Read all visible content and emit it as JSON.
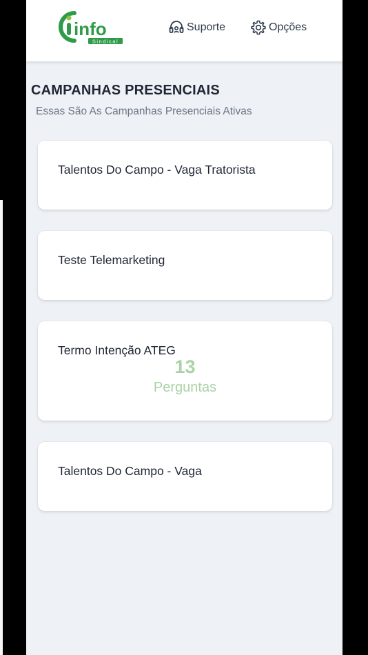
{
  "header": {
    "logo": {
      "main_text": "info",
      "sub_text": "Sindical",
      "brand_color": "#2e9b49",
      "icon": "info-sindical-logo"
    },
    "support": {
      "label": "Suporte",
      "icon": "headset-icon"
    },
    "options": {
      "label": "Opções",
      "icon": "gear-icon"
    }
  },
  "page": {
    "title": "CAMPANHAS PRESENCIAIS",
    "subtitle": "Essas São As Campanhas Presenciais Ativas"
  },
  "campaigns": [
    {
      "title": "Talentos Do Campo - Vaga Tratorista"
    },
    {
      "title": "Teste Telemarketing"
    },
    {
      "title": "Termo Intenção ATEG",
      "count": "13",
      "count_label": "Perguntas"
    },
    {
      "title": "Talentos Do Campo - Vaga"
    }
  ],
  "colors": {
    "background": "#eef1f5",
    "card": "#ffffff",
    "text": "#1f2633",
    "accent_green": "#a9d2a6"
  }
}
